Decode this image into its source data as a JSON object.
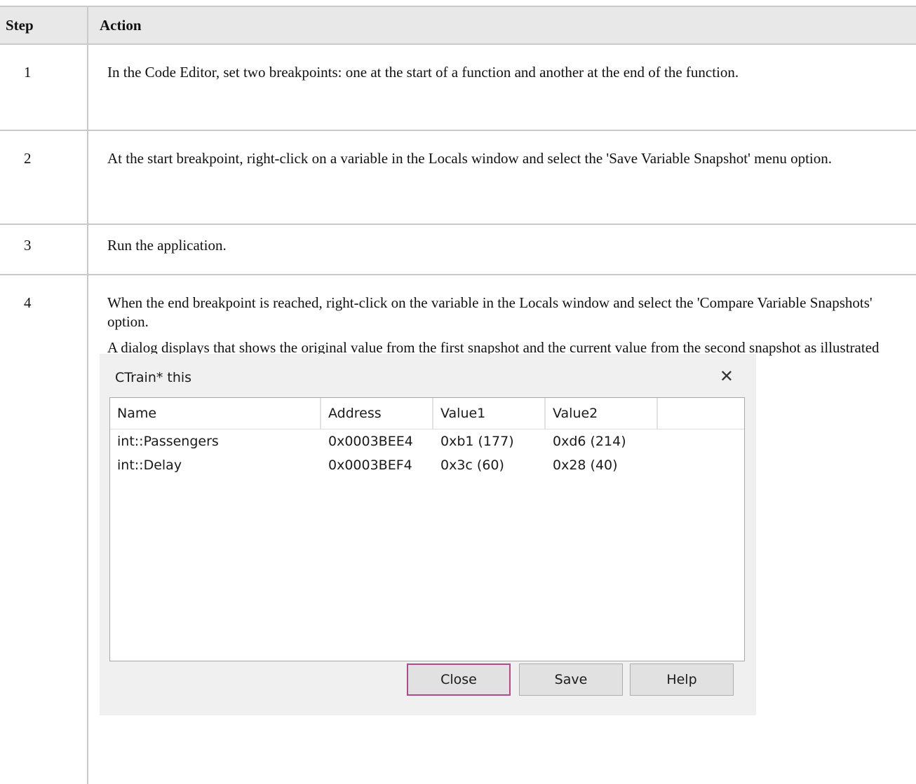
{
  "table": {
    "header": {
      "step": "Step",
      "action": "Action"
    },
    "rows": [
      {
        "step": "1",
        "action": [
          "In the Code Editor, set two breakpoints: one at the start of a function and another at the end of the function."
        ]
      },
      {
        "step": "2",
        "action": [
          "At the start breakpoint, right-click on a variable in the Locals window and select the 'Save Variable Snapshot' menu option."
        ]
      },
      {
        "step": "3",
        "action": [
          "Run the application."
        ]
      },
      {
        "step": "4",
        "action": [
          "When the end breakpoint is reached, right-click on the variable in the Locals window and select the 'Compare Variable Snapshots' option.",
          "A dialog displays that shows the original value from the first snapshot and the current value from the second snapshot as illustrated in this diagram taken from the EA.Example model."
        ]
      }
    ]
  },
  "dialog": {
    "title": "CTrain* this",
    "close_icon": "close-icon",
    "columns": [
      "Name",
      "Address",
      "Value1",
      "Value2",
      ""
    ],
    "rows": [
      {
        "name": "int::Passengers",
        "address": "0x0003BEE4",
        "value1": "0xb1 (177)",
        "value2": "0xd6 (214)"
      },
      {
        "name": "int::Delay",
        "address": "0x0003BEF4",
        "value1": "0x3c (60)",
        "value2": "0x28 (40)"
      }
    ],
    "buttons": {
      "close": "Close",
      "save": "Save",
      "help": "Help"
    }
  }
}
